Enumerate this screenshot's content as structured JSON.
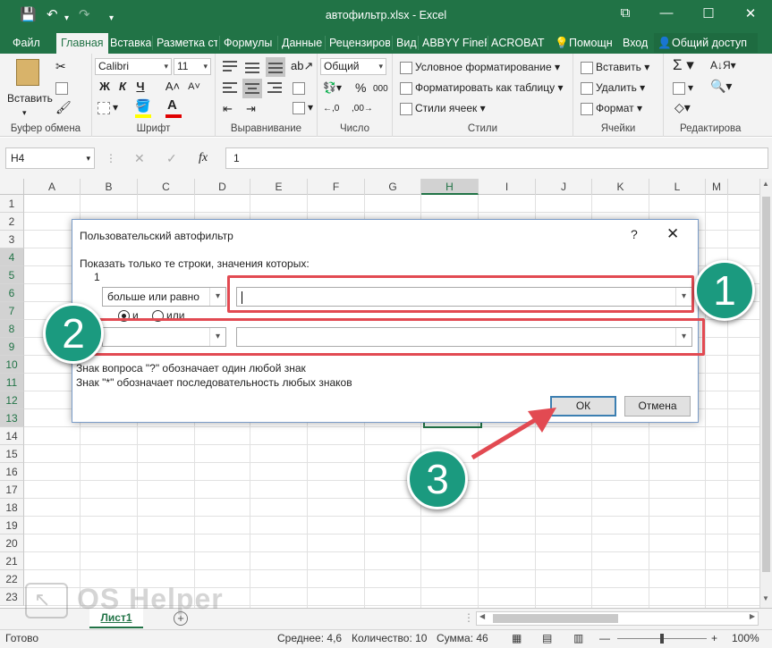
{
  "window": {
    "title": "автофильтр.xlsx - Excel",
    "minimize": "—",
    "restore": "☐",
    "close": "✕",
    "ribbon_display": "⧉"
  },
  "quick_access": {
    "save": "💾",
    "undo": "↶",
    "undo_drop": "▾",
    "redo": "↷",
    "customize": "▾"
  },
  "tabs": [
    "Файл",
    "Главная",
    "Вставка",
    "Разметка ст",
    "Формулы",
    "Данные",
    "Рецензиров",
    "Вид",
    "ABBYY FineR",
    "ACROBAT"
  ],
  "tab_active_index": 1,
  "tell_me": "Помощн",
  "signin": "Вход",
  "share": "Общий доступ",
  "ribbon": {
    "clipboard": {
      "paste": "Вставить",
      "label": "Буфер обмена"
    },
    "font": {
      "name": "Calibri",
      "size": "11",
      "bold": "Ж",
      "italic": "К",
      "underline": "Ч",
      "grow": "A˄",
      "shrink": "A˅",
      "label": "Шрифт"
    },
    "alignment": {
      "label": "Выравнивание"
    },
    "number": {
      "format": "Общий",
      "percent": "%",
      "thousands": "000",
      "label": "Число"
    },
    "styles": {
      "conditional": "Условное форматирование",
      "as_table": "Форматировать как таблицу",
      "cell_styles": "Стили ячеек",
      "label": "Стили"
    },
    "cells": {
      "insert": "Вставить",
      "delete": "Удалить",
      "format": "Формат",
      "label": "Ячейки"
    },
    "editing": {
      "label": "Редактирова"
    }
  },
  "formula_bar": {
    "name_box": "H4",
    "fx": "fx",
    "cancel": "✕",
    "enter": "✓",
    "value": "1"
  },
  "grid": {
    "columns": [
      "A",
      "B",
      "C",
      "D",
      "E",
      "F",
      "G",
      "H",
      "I",
      "J",
      "K",
      "L",
      "M"
    ],
    "selected_column": "H",
    "rows": [
      "1",
      "2",
      "3",
      "4",
      "5",
      "6",
      "7",
      "8",
      "9",
      "10",
      "11",
      "12",
      "13",
      "14",
      "15",
      "16",
      "17",
      "18",
      "19",
      "20",
      "21",
      "22",
      "23"
    ],
    "selected_rows": [
      "4",
      "5",
      "6",
      "7",
      "8",
      "9",
      "10",
      "11",
      "12",
      "13"
    ]
  },
  "sheet_tabs": [
    "Лист1"
  ],
  "add_sheet": "+",
  "status": {
    "ready": "Готово",
    "average": "Среднее: 4,6",
    "count": "Количество: 10",
    "sum": "Сумма: 46",
    "zoom": "100%",
    "zoom_minus": "—",
    "zoom_plus": "+"
  },
  "dialog": {
    "title": "Пользовательский автофильтр",
    "help": "?",
    "close": "✕",
    "instruction": "Показать только те строки, значения которых:",
    "field_name": "1",
    "condition1_operator": "больше или равно",
    "condition1_value": "",
    "and_label": "и",
    "or_label": "или",
    "condition2_operator": "",
    "condition2_value": "",
    "hint1": "Знак вопроса \"?\" обозначает один любой знак",
    "hint2": "Знак \"*\" обозначает последовательность любых знаков",
    "ok": "ОК",
    "cancel": "Отмена"
  },
  "annotations": [
    "1",
    "2",
    "3"
  ],
  "watermark": "OS Helper",
  "colors": {
    "excel_green": "#217346",
    "annotation_teal": "#1b9a7f",
    "annotation_red": "#e24a52"
  }
}
